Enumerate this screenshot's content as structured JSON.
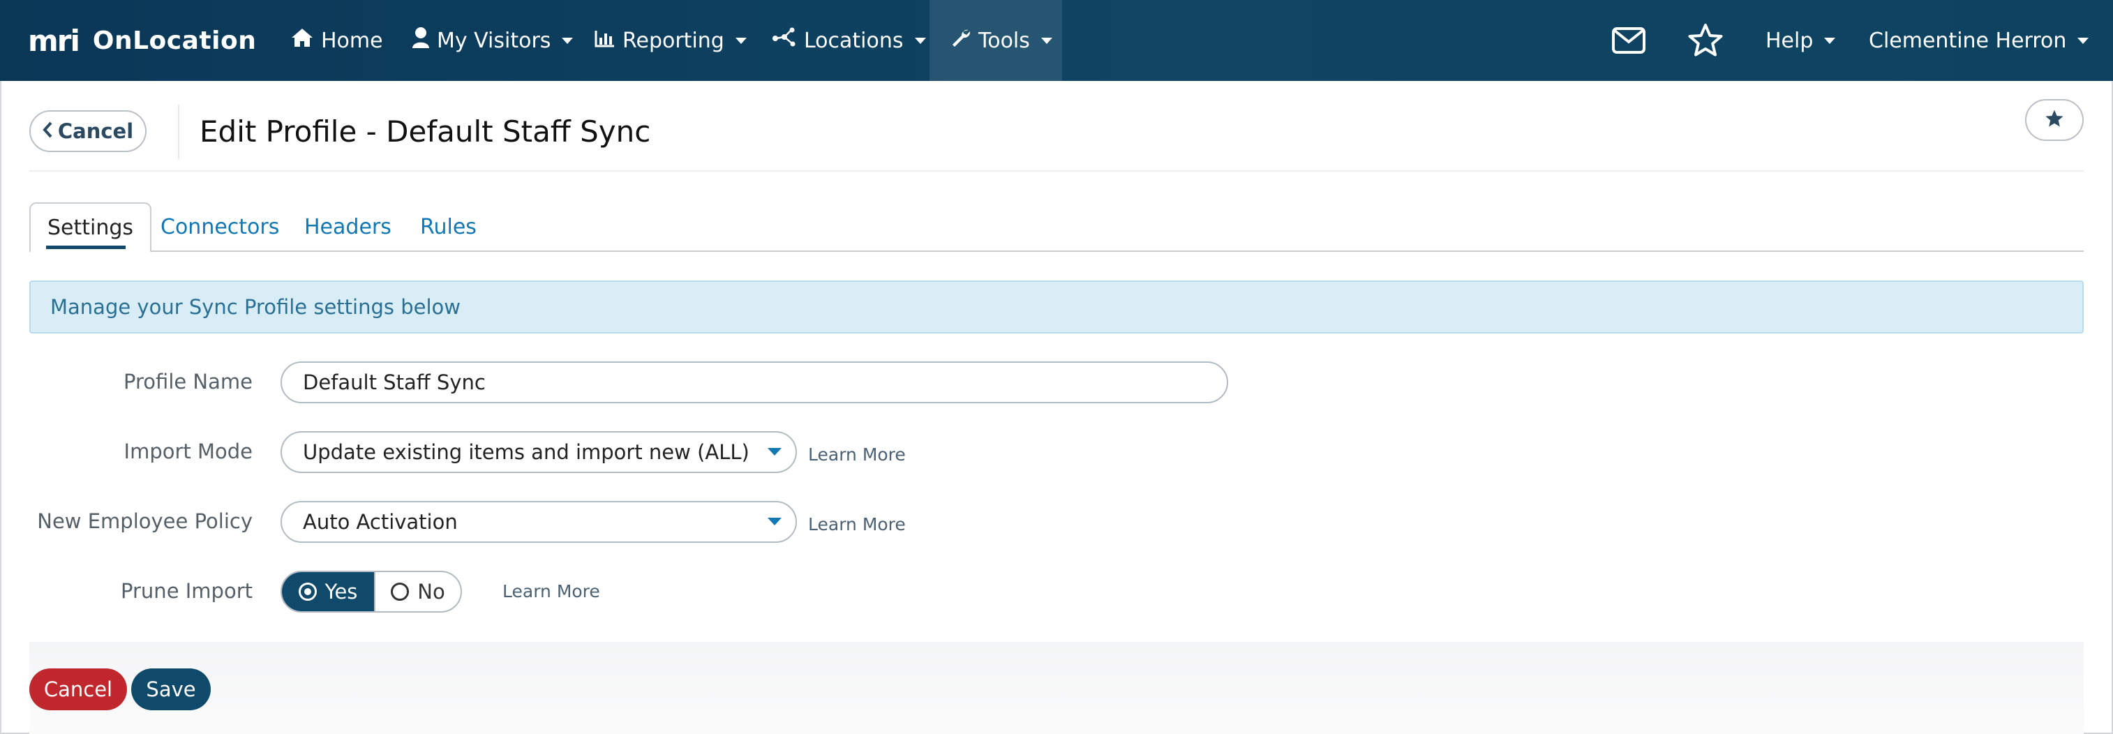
{
  "brand": {
    "logo_text": "mri",
    "app_name": "OnLocation"
  },
  "nav": {
    "items": [
      {
        "label": "Home",
        "icon": "home-icon"
      },
      {
        "label": "My Visitors",
        "icon": "user-icon"
      },
      {
        "label": "Reporting",
        "icon": "bar-chart-icon"
      },
      {
        "label": "Locations",
        "icon": "network-icon"
      },
      {
        "label": "Tools",
        "icon": "wrench-icon"
      }
    ],
    "help_label": "Help",
    "user_name": "Clementine Herron"
  },
  "header": {
    "cancel_label": "Cancel",
    "title": "Edit Profile - Default Staff Sync"
  },
  "tabs": [
    {
      "label": "Settings",
      "active": true
    },
    {
      "label": "Connectors"
    },
    {
      "label": "Headers"
    },
    {
      "label": "Rules"
    }
  ],
  "banner": {
    "text": "Manage your Sync Profile settings below"
  },
  "form": {
    "profile_name": {
      "label": "Profile Name",
      "value": "Default Staff Sync"
    },
    "import_mode": {
      "label": "Import Mode",
      "value": "Update existing items and import new (ALL)",
      "learn_more": "Learn More"
    },
    "new_employee_policy": {
      "label": "New Employee Policy",
      "value": "Auto Activation",
      "learn_more": "Learn More"
    },
    "prune_import": {
      "label": "Prune Import",
      "yes_label": "Yes",
      "no_label": "No",
      "selected": "Yes",
      "learn_more": "Learn More"
    }
  },
  "footer": {
    "cancel_label": "Cancel",
    "save_label": "Save"
  },
  "colors": {
    "nav_bg": "#0d3f5f",
    "accent_blue": "#1178b3",
    "primary_dark": "#0f4a6b",
    "danger": "#c0282d",
    "info_bg": "#d9edf6"
  }
}
